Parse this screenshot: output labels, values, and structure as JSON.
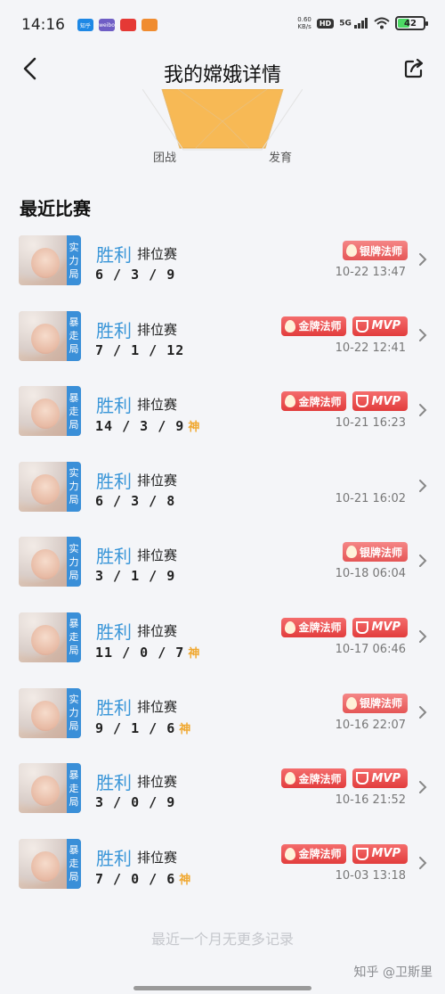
{
  "status_bar": {
    "time": "14:16",
    "net_speed_value": "0.60",
    "net_speed_unit": "KB/s",
    "hd_label": "HD",
    "signal_label": "5G",
    "battery_level": "42",
    "app_icons": [
      {
        "name": "zhihu-app-icon",
        "color": "#1e88e5",
        "label": "知乎"
      },
      {
        "name": "weibo-app-icon",
        "color": "#6f5ec5",
        "label": "weibo"
      },
      {
        "name": "app-icon-3",
        "color": "#e53935",
        "label": ""
      },
      {
        "name": "game-app-icon",
        "color": "#f08c30",
        "label": ""
      }
    ]
  },
  "header": {
    "title": "我的嫦娥详情"
  },
  "radar": {
    "label_left": "团战",
    "label_right": "发育",
    "fill_color": "#f7b955"
  },
  "section": {
    "title": "最近比赛"
  },
  "colors": {
    "result_win": "#3a96d8",
    "mode_tag": "#3a8fd8",
    "badge_red": "#e23d3d",
    "god_tag": "#f0a830"
  },
  "matches": [
    {
      "mode": [
        "实",
        "力",
        "局"
      ],
      "result": "胜利",
      "type": "排位赛",
      "kda": "6 / 3 / 9",
      "god": "",
      "badges": [
        "银牌法师"
      ],
      "mvp": "",
      "time": "10-22 13:47"
    },
    {
      "mode": [
        "暴",
        "走",
        "局"
      ],
      "result": "胜利",
      "type": "排位赛",
      "kda": "7 / 1 / 12",
      "god": "",
      "badges": [
        "金牌法师"
      ],
      "mvp": "MVP",
      "time": "10-22 12:41"
    },
    {
      "mode": [
        "暴",
        "走",
        "局"
      ],
      "result": "胜利",
      "type": "排位赛",
      "kda": "14 / 3 / 9",
      "god": "神",
      "badges": [
        "金牌法师"
      ],
      "mvp": "MVP",
      "time": "10-21 16:23"
    },
    {
      "mode": [
        "实",
        "力",
        "局"
      ],
      "result": "胜利",
      "type": "排位赛",
      "kda": "6 / 3 / 8",
      "god": "",
      "badges": [],
      "mvp": "",
      "time": "10-21 16:02"
    },
    {
      "mode": [
        "实",
        "力",
        "局"
      ],
      "result": "胜利",
      "type": "排位赛",
      "kda": "3 / 1 / 9",
      "god": "",
      "badges": [
        "银牌法师"
      ],
      "mvp": "",
      "time": "10-18 06:04"
    },
    {
      "mode": [
        "暴",
        "走",
        "局"
      ],
      "result": "胜利",
      "type": "排位赛",
      "kda": "11 / 0 / 7",
      "god": "神",
      "badges": [
        "金牌法师"
      ],
      "mvp": "MVP",
      "time": "10-17 06:46"
    },
    {
      "mode": [
        "实",
        "力",
        "局"
      ],
      "result": "胜利",
      "type": "排位赛",
      "kda": "9 / 1 / 6",
      "god": "神",
      "badges": [
        "银牌法师"
      ],
      "mvp": "",
      "time": "10-16 22:07"
    },
    {
      "mode": [
        "暴",
        "走",
        "局"
      ],
      "result": "胜利",
      "type": "排位赛",
      "kda": "3 / 0 / 9",
      "god": "",
      "badges": [
        "金牌法师"
      ],
      "mvp": "MVP",
      "time": "10-16 21:52"
    },
    {
      "mode": [
        "暴",
        "走",
        "局"
      ],
      "result": "胜利",
      "type": "排位赛",
      "kda": "7 / 0 / 6",
      "god": "神",
      "badges": [
        "金牌法师"
      ],
      "mvp": "MVP",
      "time": "10-03 13:18"
    }
  ],
  "footer": {
    "note": "最近一个月无更多记录",
    "watermark": "知乎 @卫斯里"
  }
}
